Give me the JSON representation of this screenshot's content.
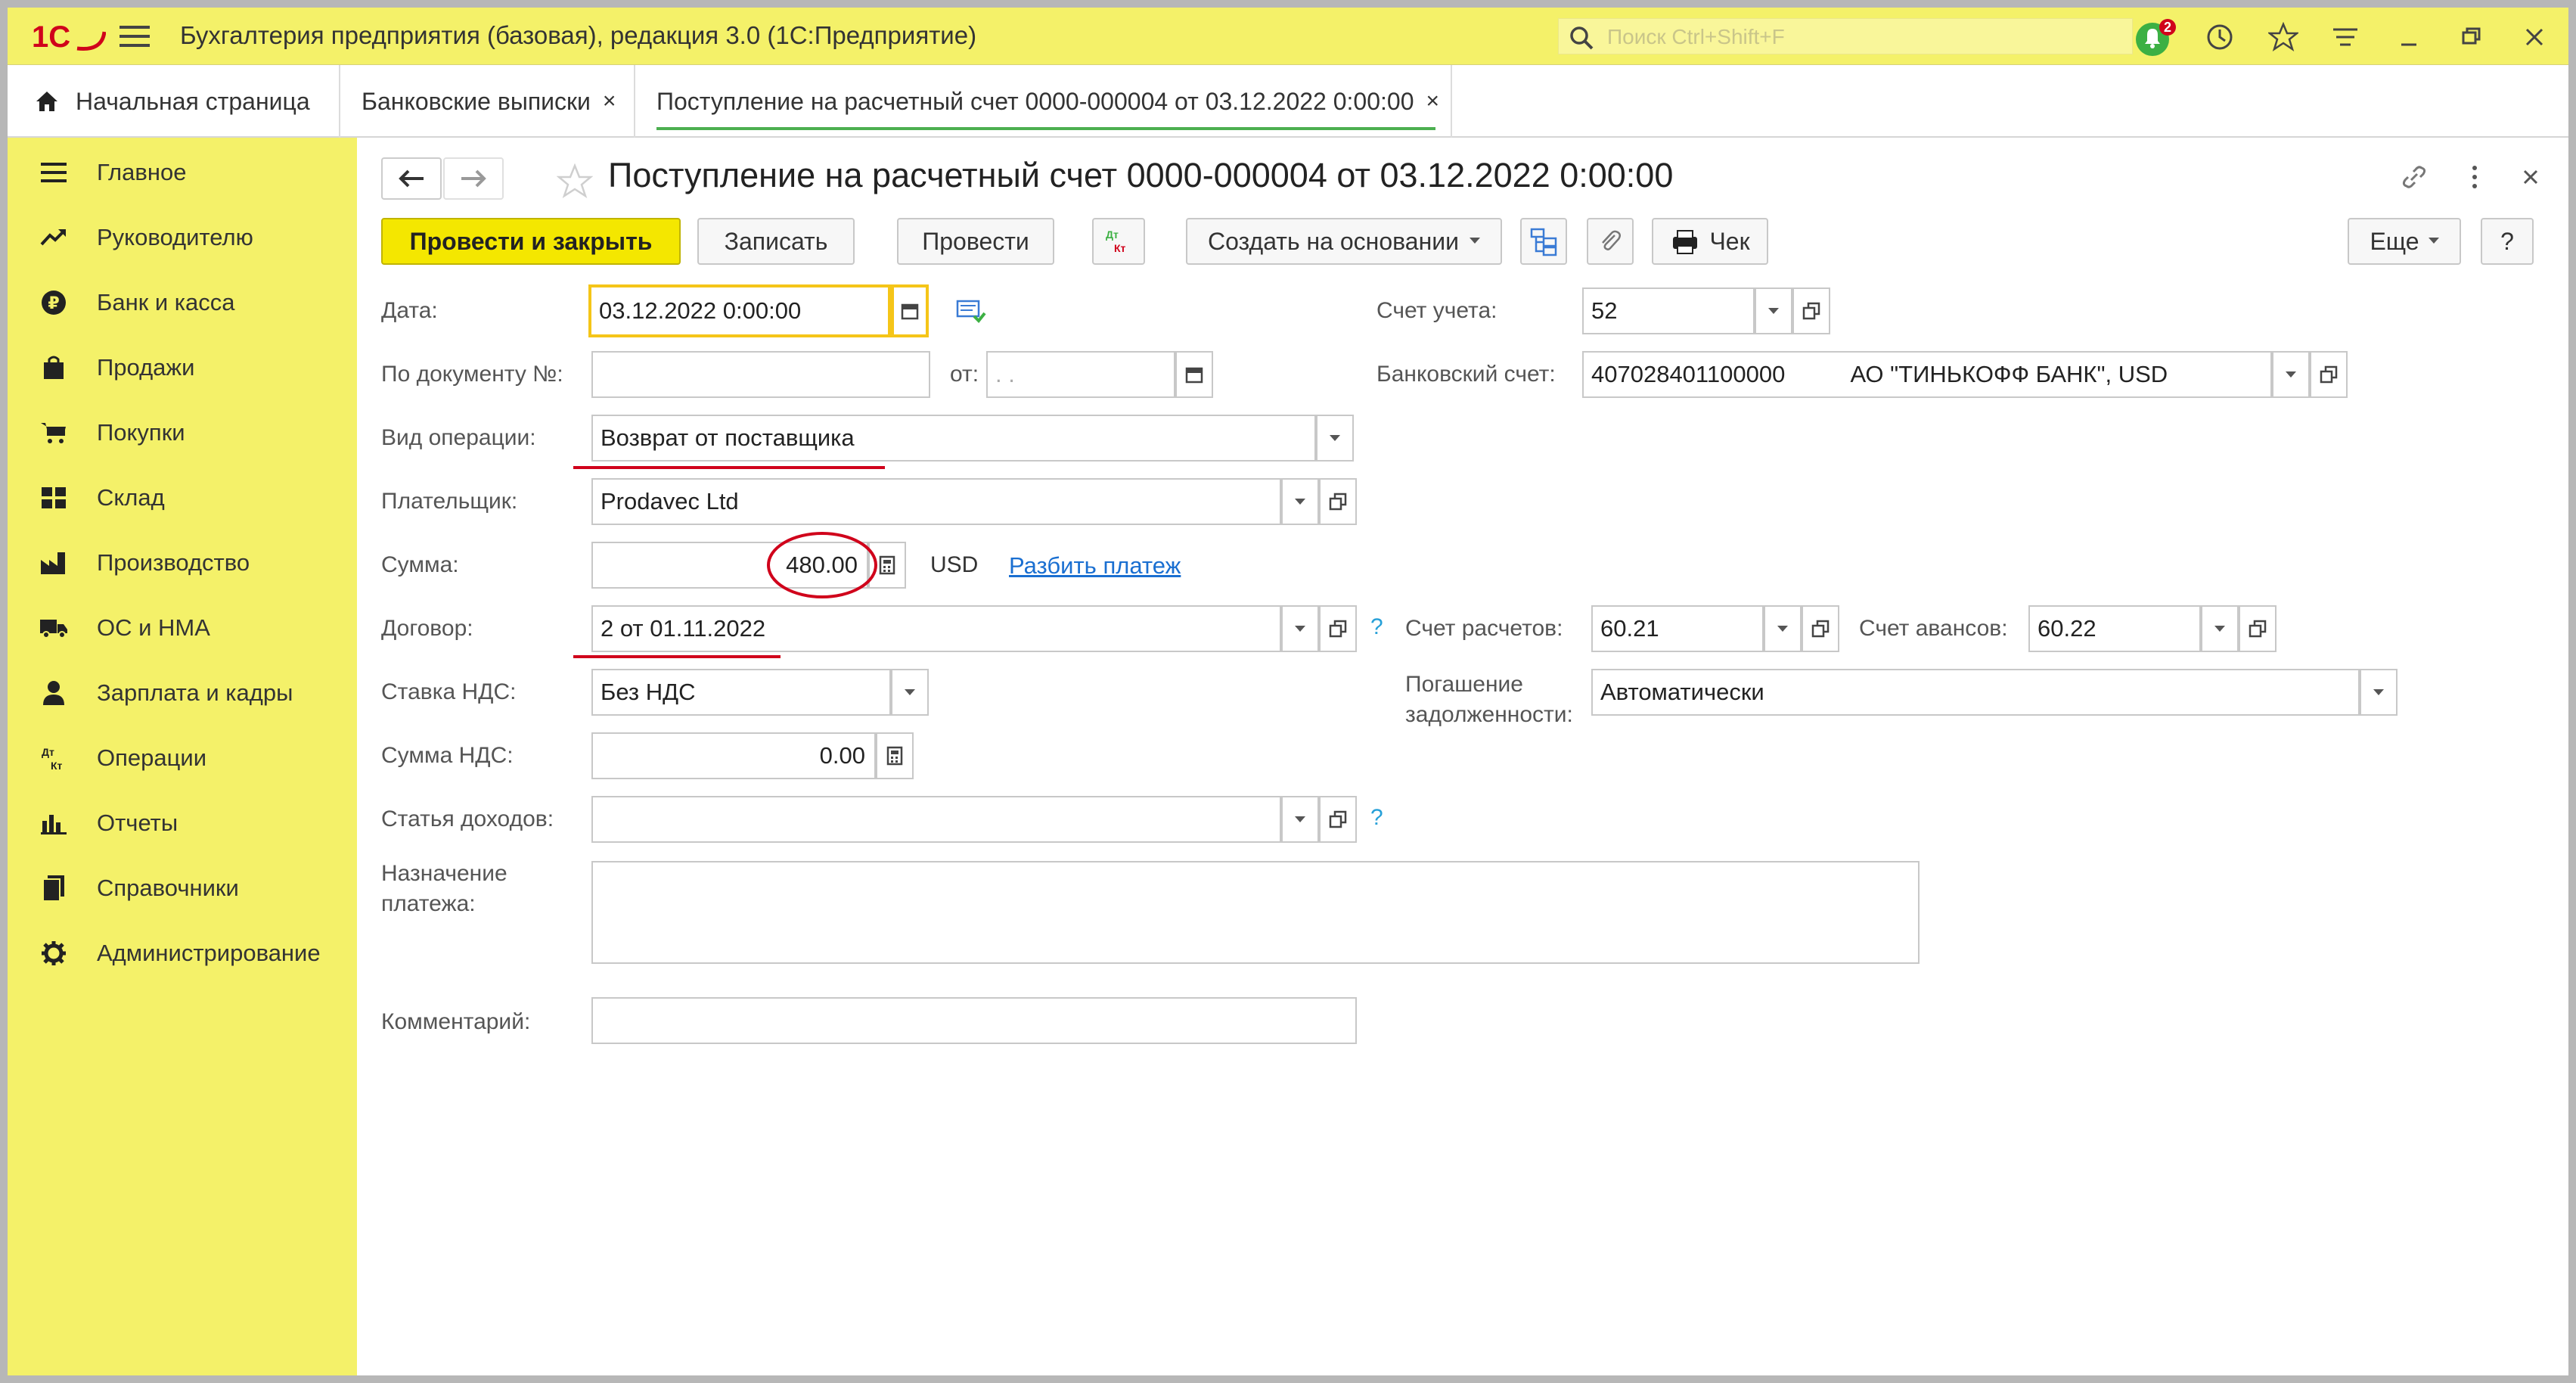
{
  "app": {
    "title": "Бухгалтерия предприятия (базовая), редакция 3.0  (1С:Предприятие)",
    "logo_text": "1С",
    "search_placeholder": "Поиск Ctrl+Shift+F",
    "notification_count": "2",
    "accent_color": "#f4f169"
  },
  "tabs": [
    {
      "label": "Начальная страница"
    },
    {
      "label": "Банковские выписки",
      "close": "×"
    },
    {
      "label": "Поступление на расчетный счет 0000-000004 от 03.12.2022 0:00:00",
      "close": "×"
    }
  ],
  "sidebar": {
    "items": [
      {
        "label": "Главное",
        "icon": "menu-icon"
      },
      {
        "label": "Руководителю",
        "icon": "trend-icon"
      },
      {
        "label": "Банк и касса",
        "icon": "ruble-icon"
      },
      {
        "label": "Продажи",
        "icon": "shopping-bag-icon"
      },
      {
        "label": "Покупки",
        "icon": "cart-icon"
      },
      {
        "label": "Склад",
        "icon": "warehouse-icon"
      },
      {
        "label": "Производство",
        "icon": "factory-icon"
      },
      {
        "label": "ОС и НМА",
        "icon": "truck-icon"
      },
      {
        "label": "Зарплата и кадры",
        "icon": "person-icon"
      },
      {
        "label": "Операции",
        "icon": "dt-kt-icon"
      },
      {
        "label": "Отчеты",
        "icon": "bar-chart-icon"
      },
      {
        "label": "Справочники",
        "icon": "books-icon"
      },
      {
        "label": "Администрирование",
        "icon": "gear-icon"
      }
    ]
  },
  "document": {
    "title": "Поступление на расчетный счет 0000-000004 от 03.12.2022 0:00:00"
  },
  "toolbar": {
    "post_close": "Провести и закрыть",
    "save": "Записать",
    "post": "Провести",
    "dtkt": "Дт Кт",
    "create_based": "Создать на основании",
    "check": "Чек",
    "more": "Еще",
    "help": "?"
  },
  "form": {
    "date_label": "Дата:",
    "date_value": "03.12.2022  0:00:00",
    "doc_no_label": "По документу №:",
    "doc_no_value": "",
    "from_label": "от:",
    "from_value": " .  .",
    "op_type_label": "Вид операции:",
    "op_type_value": "Возврат от поставщика",
    "payer_label": "Плательщик:",
    "payer_value": "Prodavec Ltd",
    "sum_label": "Сумма:",
    "sum_value": "480.00",
    "currency": "USD",
    "split_link": "Разбить платеж",
    "contract_label": "Договор:",
    "contract_value": "2 от 01.11.2022",
    "vat_rate_label": "Ставка НДС:",
    "vat_rate_value": "Без НДС",
    "vat_sum_label": "Сумма НДС:",
    "vat_sum_value": "0.00",
    "income_label": "Статья доходов:",
    "income_value": "",
    "purpose_label_1": "Назначение",
    "purpose_label_2": "платежа:",
    "purpose_value": "",
    "comment_label": "Комментарий:",
    "comment_value": "",
    "account_label": "Счет учета:",
    "account_value": "52",
    "bank_account_label": "Банковский счет:",
    "bank_account_value": "407028401100000          АО \"ТИНЬКОФФ БАНК\", USD",
    "settle_label": "Счет расчетов:",
    "settle_value": "60.21",
    "advance_label": "Счет авансов:",
    "advance_value": "60.22",
    "debt_label_1": "Погашение",
    "debt_label_2": "задолженности:",
    "debt_value": "Автоматически",
    "help_mark": "?"
  }
}
